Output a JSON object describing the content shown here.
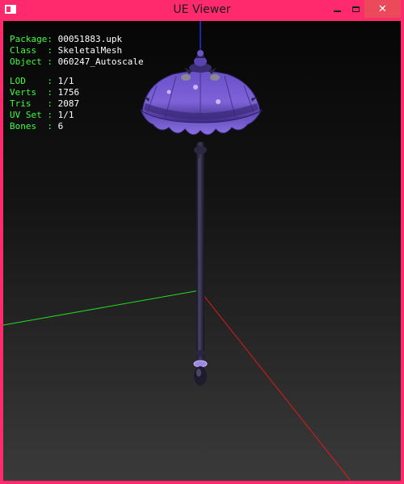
{
  "window": {
    "title": "UE Viewer",
    "controls": {
      "minimize_icon": "minimize-icon",
      "maximize_icon": "maximize-icon",
      "close_glyph": "✕"
    }
  },
  "info": {
    "package_label": "Package:",
    "package_value": "00051883.upk",
    "class_label": "Class  :",
    "class_value": "SkeletalMesh",
    "object_label": "Object :",
    "object_value": "060247_Autoscale",
    "lod_label": "LOD    :",
    "lod_value": "1/1",
    "verts_label": "Verts  :",
    "verts_value": "1756",
    "tris_label": "Tris   :",
    "tris_value": "2087",
    "uvset_label": "UV Set :",
    "uvset_value": "1/1",
    "bones_label": "Bones  :",
    "bones_value": "6"
  },
  "scene": {
    "model": "purple-parasol-skeletal-mesh",
    "axis_x_color": "#e01a1a",
    "axis_y_color": "#22dd22",
    "axis_z_color": "#2233dd"
  },
  "colors": {
    "frame": "#ff2a6d",
    "close_button": "#ea4a5a",
    "info_label": "#3aff3a",
    "info_value": "#ffffff"
  }
}
